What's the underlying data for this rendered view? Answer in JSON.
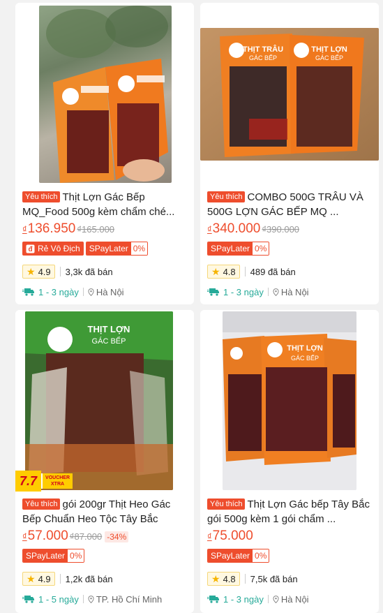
{
  "colors": {
    "brand": "#ee4d2d",
    "ship": "#26aa99",
    "star": "#f6b400"
  },
  "products": [
    {
      "tag": "Yêu thích",
      "title": "Thịt Lợn Gác Bếp MQ_Food 500g kèm chẩm ché...",
      "price_symbol": "₫",
      "price": "136.950",
      "old_price": "₫165.000",
      "discount": "",
      "badge": "Rẻ Vô Địch",
      "spaylater": "SPayLater",
      "spaylater_rate": "0%",
      "rating": "4.9",
      "sold": "3,3k đã bán",
      "delivery": "1 - 3 ngày",
      "location": "Hà Nội",
      "icon_star": "star-icon",
      "icon_truck": "truck-icon",
      "icon_pin": "location-pin-icon"
    },
    {
      "tag": "Yêu thích",
      "title": "COMBO 500G TRÂU VÀ 500G LỢN GÁC BẾP MQ ...",
      "price_symbol": "₫",
      "price": "340.000",
      "old_price": "₫390.000",
      "discount": "",
      "badge": "",
      "spaylater": "SPayLater",
      "spaylater_rate": "0%",
      "rating": "4.8",
      "sold": "489 đã bán",
      "delivery": "1 - 3 ngày",
      "location": "Hà Nội"
    },
    {
      "tag": "Yêu thích",
      "title": "gói 200gr Thịt Heo Gác Bếp Chuẩn Heo Tộc Tây Bắc",
      "price_symbol": "₫",
      "price": "57.000",
      "old_price": "₫87.000",
      "discount": "-34%",
      "badge": "",
      "spaylater": "SPayLater",
      "spaylater_rate": "0%",
      "rating": "4.9",
      "sold": "1,2k đã bán",
      "delivery": "1 - 5 ngày",
      "location": "TP. Hồ Chí Minh",
      "promo_main": "7.7",
      "promo_voucher": "VOUCHER",
      "promo_extra": "XTRA"
    },
    {
      "tag": "Yêu thích",
      "title": "Thịt Lợn Gác bếp Tây Bắc gói 500g kèm 1 gói chẩm ...",
      "price_symbol": "₫",
      "price": "75.000",
      "old_price": "",
      "discount": "",
      "badge": "",
      "spaylater": "SPayLater",
      "spaylater_rate": "0%",
      "rating": "4.8",
      "sold": "7,5k đã bán",
      "delivery": "1 - 3 ngày",
      "location": "Hà Nội"
    }
  ]
}
